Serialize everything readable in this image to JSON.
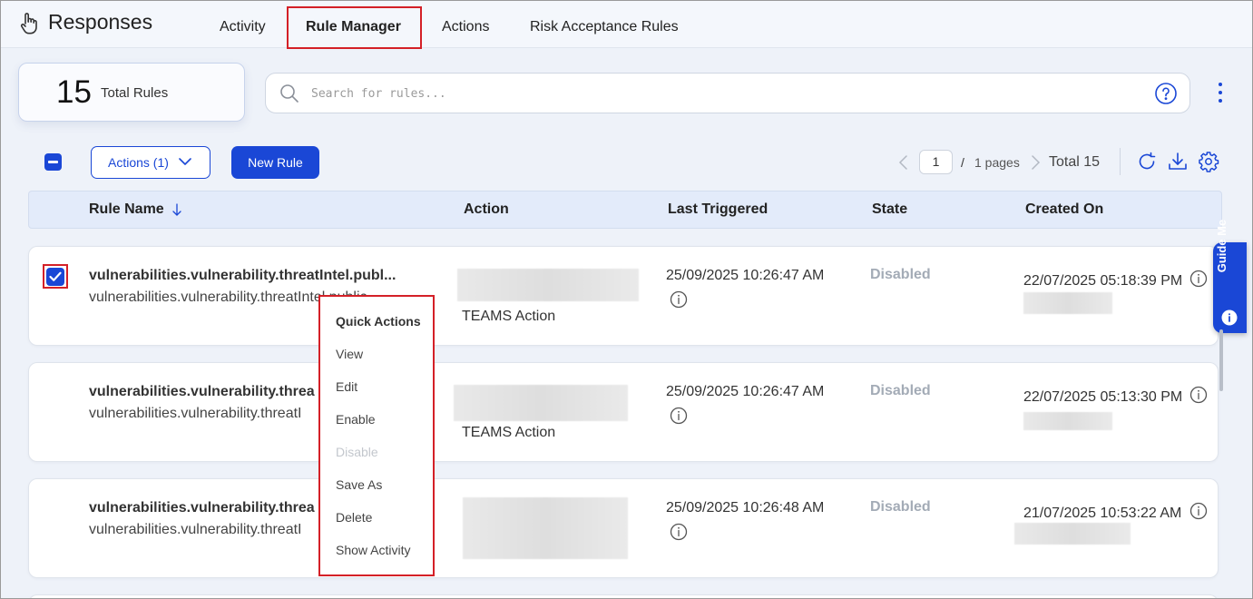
{
  "header": {
    "title": "Responses",
    "tabs": [
      {
        "label": "Activity",
        "active": false
      },
      {
        "label": "Rule Manager",
        "active": true
      },
      {
        "label": "Actions",
        "active": false
      },
      {
        "label": "Risk Acceptance Rules",
        "active": false
      }
    ]
  },
  "summary": {
    "count": "15",
    "label": "Total Rules"
  },
  "search": {
    "placeholder": "Search for rules...",
    "value": ""
  },
  "toolbar": {
    "actions_label": "Actions (1)",
    "new_rule_label": "New Rule",
    "page_value": "1",
    "page_sep": "/",
    "pages_label": "1 pages",
    "total_label": "Total 15"
  },
  "columns": {
    "rule_name": "Rule Name",
    "action": "Action",
    "last_triggered": "Last Triggered",
    "state": "State",
    "created_on": "Created On"
  },
  "rows": [
    {
      "selected": true,
      "name": "vulnerabilities.vulnerability.threatIntel.publ...",
      "subtitle": "vulnerabilities.vulnerability.threatIntel.public...",
      "action_visible": "TEAMS Action",
      "last_triggered": "25/09/2025 10:26:47 AM",
      "state": "Disabled",
      "created_on": "22/07/2025 05:18:39 PM"
    },
    {
      "selected": false,
      "name": "vulnerabilities.vulnerability.threa",
      "subtitle": "vulnerabilities.vulnerability.threatI",
      "action_visible": "TEAMS Action",
      "last_triggered": "25/09/2025 10:26:47 AM",
      "state": "Disabled",
      "created_on": "22/07/2025 05:13:30 PM"
    },
    {
      "selected": false,
      "name": "vulnerabilities.vulnerability.threa",
      "subtitle": "vulnerabilities.vulnerability.threatI",
      "action_visible": "",
      "last_triggered": "25/09/2025 10:26:48 AM",
      "state": "Disabled",
      "created_on": "21/07/2025 10:53:22 AM"
    }
  ],
  "context_menu": {
    "title": "Quick Actions",
    "items": [
      {
        "label": "View",
        "enabled": true
      },
      {
        "label": "Edit",
        "enabled": true
      },
      {
        "label": "Enable",
        "enabled": true
      },
      {
        "label": "Disable",
        "enabled": false
      },
      {
        "label": "Save As",
        "enabled": true
      },
      {
        "label": "Delete",
        "enabled": true
      },
      {
        "label": "Show Activity",
        "enabled": true
      }
    ]
  },
  "guide": {
    "label": "Guide Me"
  },
  "colors": {
    "primary": "#1a47d6",
    "highlight": "#d42027",
    "state_disabled": "#a3abb6"
  },
  "icons": [
    "hand-pointer-icon",
    "search-icon",
    "help-circle-icon",
    "kebab-menu-icon",
    "chevron-down-icon",
    "chevron-left-icon",
    "chevron-right-icon",
    "refresh-icon",
    "download-icon",
    "settings-gear-icon",
    "sort-down-icon",
    "info-icon",
    "checkbox-checked-icon"
  ]
}
